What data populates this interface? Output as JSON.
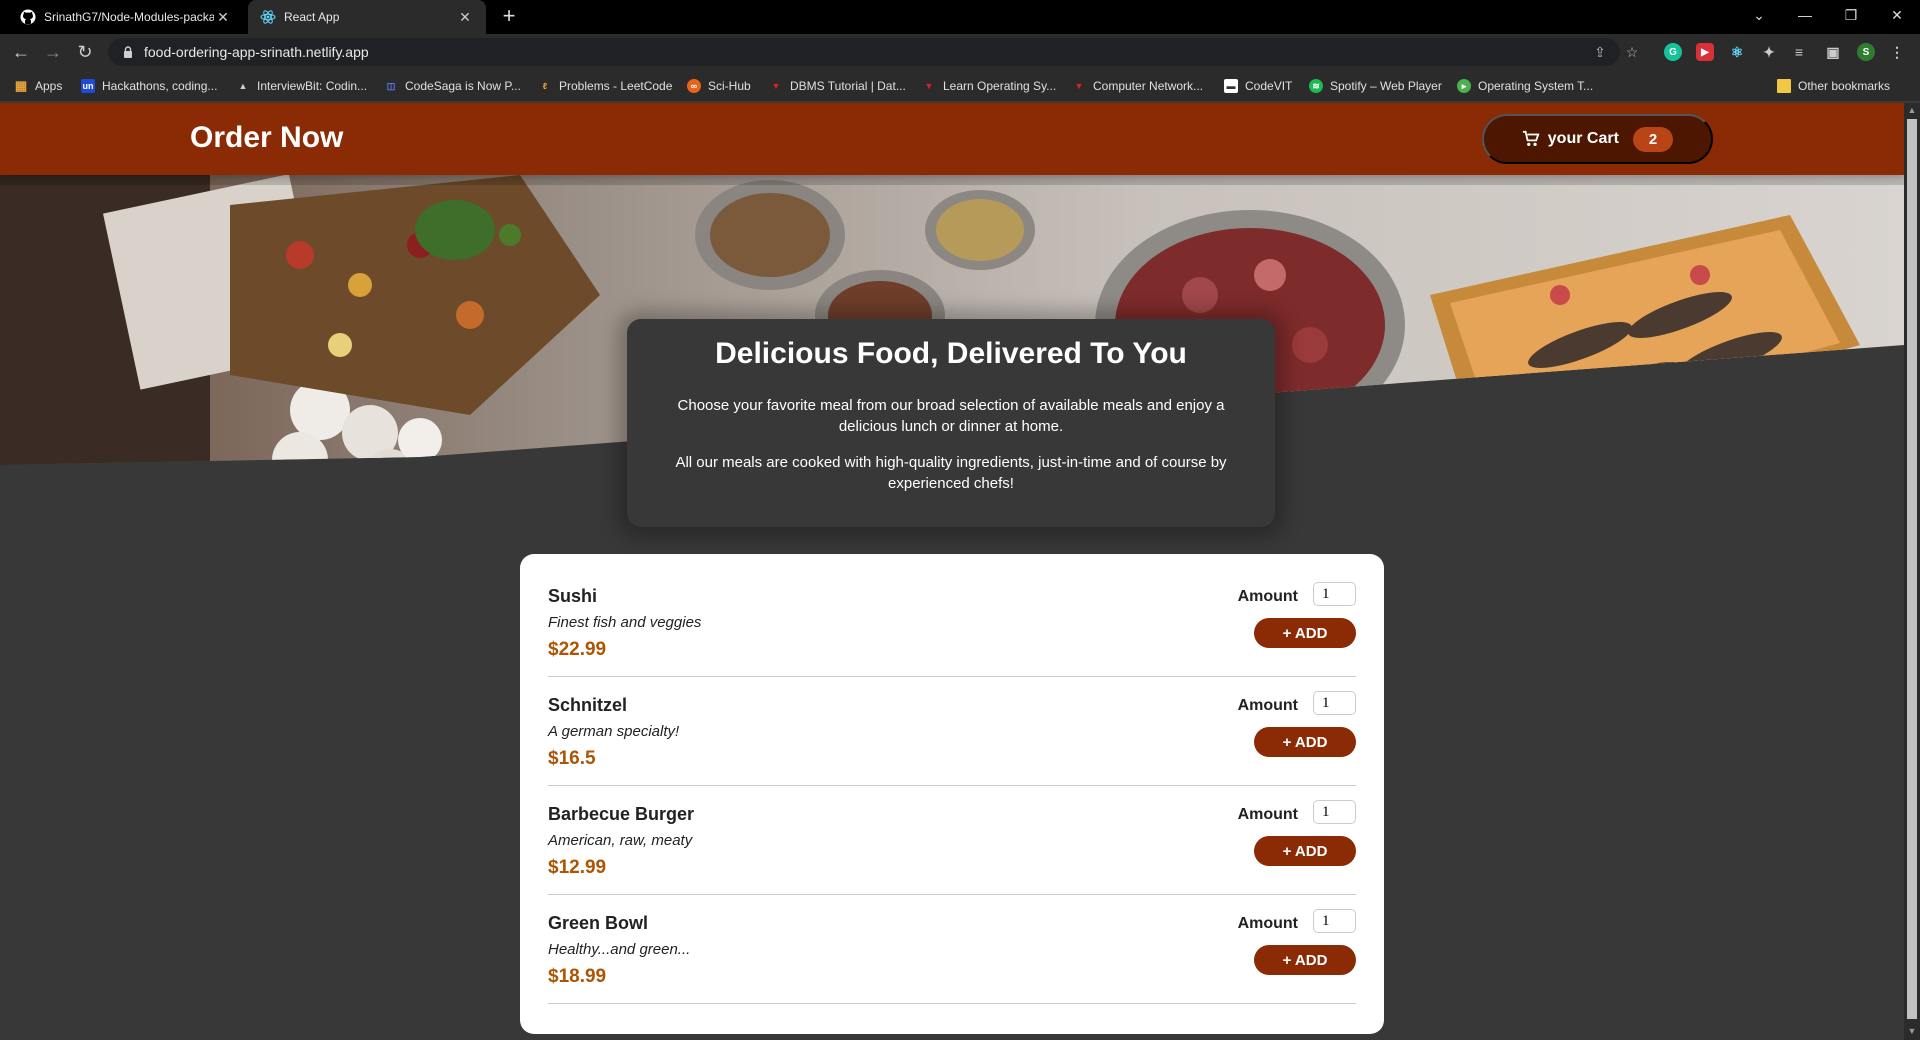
{
  "browser": {
    "tabs": [
      {
        "title": "SrinathG7/Node-Modules-packa",
        "icon": "github-icon",
        "active": false
      },
      {
        "title": "React App",
        "icon": "react-icon",
        "active": true
      }
    ],
    "url": "food-ordering-app-srinath.netlify.app",
    "bookmarks": [
      {
        "label": "Apps",
        "icon": "apps-grid-icon",
        "color": "#e8a33d"
      },
      {
        "label": "Hackathons, coding...",
        "icon": "unstop-icon",
        "color": "#1f4bd8"
      },
      {
        "label": "InterviewBit: Codin...",
        "icon": "interviewbit-icon",
        "color": "#d0d0d0"
      },
      {
        "label": "CodeSaga is Now P...",
        "icon": "codesaga-icon",
        "color": "#3b5bdb"
      },
      {
        "label": "Problems - LeetCode",
        "icon": "leetcode-icon",
        "color": "#f0a33a"
      },
      {
        "label": "Sci-Hub",
        "icon": "scihub-icon",
        "color": "#e8641b"
      },
      {
        "label": "DBMS Tutorial | Dat...",
        "icon": "tutorial-icon",
        "color": "#e02020"
      },
      {
        "label": "Learn Operating Sy...",
        "icon": "tutorial-icon",
        "color": "#e02020"
      },
      {
        "label": "Computer Network...",
        "icon": "tutorial-icon",
        "color": "#e02020"
      },
      {
        "label": "CodeVIT",
        "icon": "codevit-icon",
        "color": "#ffffff"
      },
      {
        "label": "Spotify – Web Player",
        "icon": "spotify-icon",
        "color": "#1db954"
      },
      {
        "label": "Operating System T...",
        "icon": "os-tutorial-icon",
        "color": "#4caf50"
      }
    ],
    "other_bookmarks": "Other bookmarks",
    "profile_initial": "S"
  },
  "header": {
    "brand": "Order Now",
    "cart_label": "your Cart",
    "cart_count": "2"
  },
  "summary": {
    "title": "Delicious Food, Delivered To You",
    "para1": "Choose your favorite meal from our broad selection of available meals and enjoy a delicious lunch or dinner at home.",
    "para2": "All our meals are cooked with high-quality ingredients, just-in-time and of course by experienced chefs!"
  },
  "meals": {
    "amount_label": "Amount",
    "add_label": "+ ADD",
    "items": [
      {
        "name": "Sushi",
        "description": "Finest fish and veggies",
        "price": "$22.99",
        "amount": "1"
      },
      {
        "name": "Schnitzel",
        "description": "A german specialty!",
        "price": "$16.5",
        "amount": "1"
      },
      {
        "name": "Barbecue Burger",
        "description": "American, raw, meaty",
        "price": "$12.99",
        "amount": "1"
      },
      {
        "name": "Green Bowl",
        "description": "Healthy...and green...",
        "price": "$18.99",
        "amount": "1"
      }
    ]
  },
  "colors": {
    "header": "#8a2b06",
    "cart_button": "#4d1601",
    "badge": "#b94517",
    "price": "#ad5502",
    "page_bg": "#383838"
  }
}
